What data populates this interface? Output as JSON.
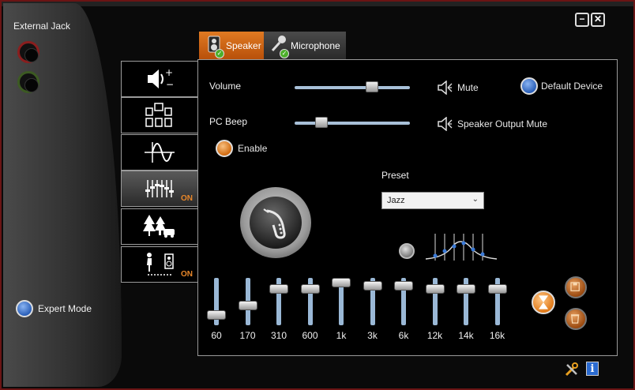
{
  "left_panel": {
    "title": "External Jack",
    "expert_mode_label": "Expert Mode"
  },
  "window_controls": {
    "minimize": "−",
    "close": "✕"
  },
  "tabs": [
    {
      "label": "Speaker",
      "selected": true
    },
    {
      "label": "Microphone",
      "selected": false
    }
  ],
  "side_buttons": [
    {
      "name": "speaker-volume",
      "on_label": ""
    },
    {
      "name": "speaker-configuration",
      "on_label": ""
    },
    {
      "name": "sound-effects",
      "on_label": ""
    },
    {
      "name": "equalizer",
      "on_label": "ON"
    },
    {
      "name": "environment",
      "on_label": ""
    },
    {
      "name": "room-correction",
      "on_label": "ON"
    }
  ],
  "main": {
    "volume_label": "Volume",
    "volume_level": 0.67,
    "mute_label": "Mute",
    "default_device_label": "Default Device",
    "pc_beep_label": "PC Beep",
    "pc_beep_level": 0.23,
    "speaker_output_mute_label": "Speaker Output Mute",
    "enable_label": "Enable",
    "preset_label": "Preset",
    "preset_value": "Jazz"
  },
  "equalizer": {
    "bands": [
      {
        "label": "60",
        "level": 0.1
      },
      {
        "label": "170",
        "level": 0.35
      },
      {
        "label": "310",
        "level": 0.8
      },
      {
        "label": "600",
        "level": 0.8
      },
      {
        "label": "1k",
        "level": 0.95
      },
      {
        "label": "3k",
        "level": 0.88
      },
      {
        "label": "6k",
        "level": 0.88
      },
      {
        "label": "12k",
        "level": 0.8
      },
      {
        "label": "14k",
        "level": 0.8
      },
      {
        "label": "16k",
        "level": 0.8
      }
    ]
  },
  "colors": {
    "accent_orange": "#e07a22",
    "slider_track": "#a8c0d8",
    "on_text": "#e8872a",
    "radio_blue": "#2a5fb8"
  },
  "icons": {
    "tools": "tools-icon",
    "info": "i"
  }
}
